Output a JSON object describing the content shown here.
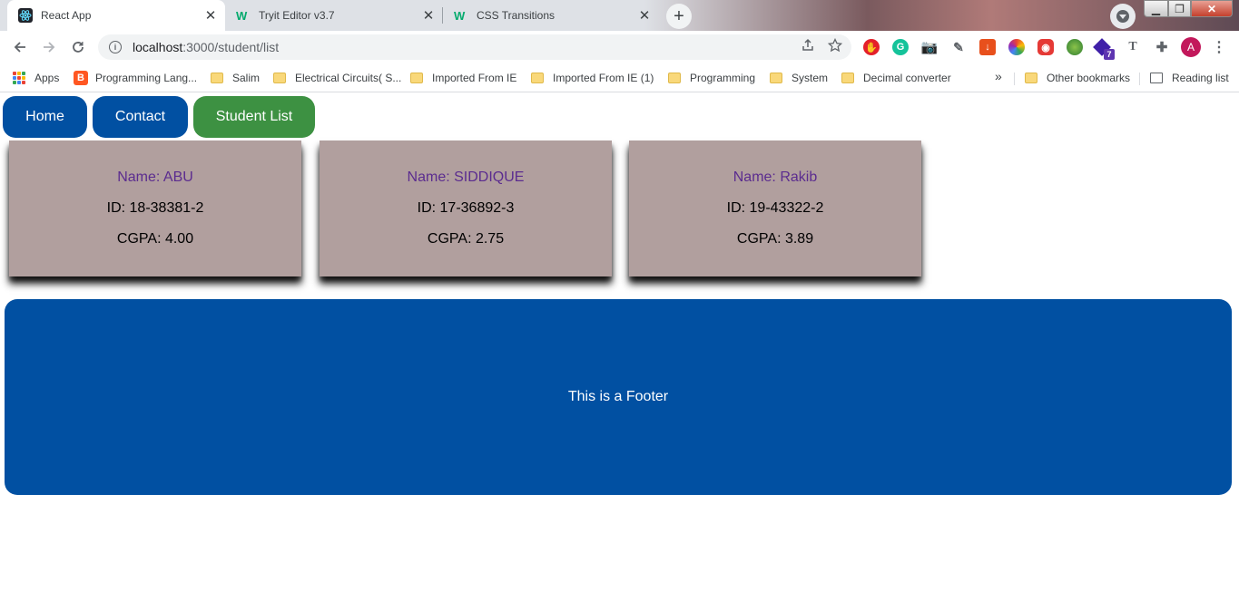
{
  "browser": {
    "tabs": [
      {
        "title": "React App",
        "icon": "react-icon",
        "active": true
      },
      {
        "title": "Tryit Editor v3.7",
        "icon": "w3schools-icon",
        "active": false
      },
      {
        "title": "CSS Transitions",
        "icon": "w3schools-icon",
        "active": false
      }
    ],
    "tab_close": "✕",
    "new_tab": "+",
    "address": {
      "host": "localhost",
      "path": ":3000/student/list"
    },
    "window_controls": {
      "minimize": "▁",
      "maximize": "❐",
      "close": "✕"
    },
    "avatar_letter": "A",
    "bookmarks": [
      {
        "label": "Apps",
        "icon": "apps-grid-icon"
      },
      {
        "label": "Programming Lang...",
        "icon": "blogger-icon"
      },
      {
        "label": "Salim",
        "icon": "folder-icon"
      },
      {
        "label": "Electrical Circuits( S...",
        "icon": "folder-icon"
      },
      {
        "label": "Imported From IE",
        "icon": "folder-icon"
      },
      {
        "label": "Imported From IE (1)",
        "icon": "folder-icon"
      },
      {
        "label": "Programming",
        "icon": "folder-icon"
      },
      {
        "label": "System",
        "icon": "folder-icon"
      },
      {
        "label": "Decimal converter",
        "icon": "folder-icon"
      }
    ],
    "bookmarks_overflow": "»",
    "other_bookmarks": "Other bookmarks",
    "reading_list": "Reading list",
    "extension_badge": "7"
  },
  "nav": {
    "links": [
      {
        "label": "Home",
        "color": "#0150a2"
      },
      {
        "label": "Contact",
        "color": "#0150a2"
      },
      {
        "label": "Student List",
        "color": "#3d9142"
      }
    ]
  },
  "students": [
    {
      "name": "Name: ABU",
      "id": "ID: 18-38381-2",
      "cgpa": "CGPA: 4.00"
    },
    {
      "name": "Name: SIDDIQUE",
      "id": "ID: 17-36892-3",
      "cgpa": "CGPA: 2.75"
    },
    {
      "name": "Name: Rakib",
      "id": "ID: 19-43322-2",
      "cgpa": "CGPA: 3.89"
    }
  ],
  "footer": {
    "text": "This is a Footer",
    "color": "#0150a2"
  },
  "colors": {
    "card_bg": "#b19f9e",
    "name_text": "#5b2c8f"
  }
}
